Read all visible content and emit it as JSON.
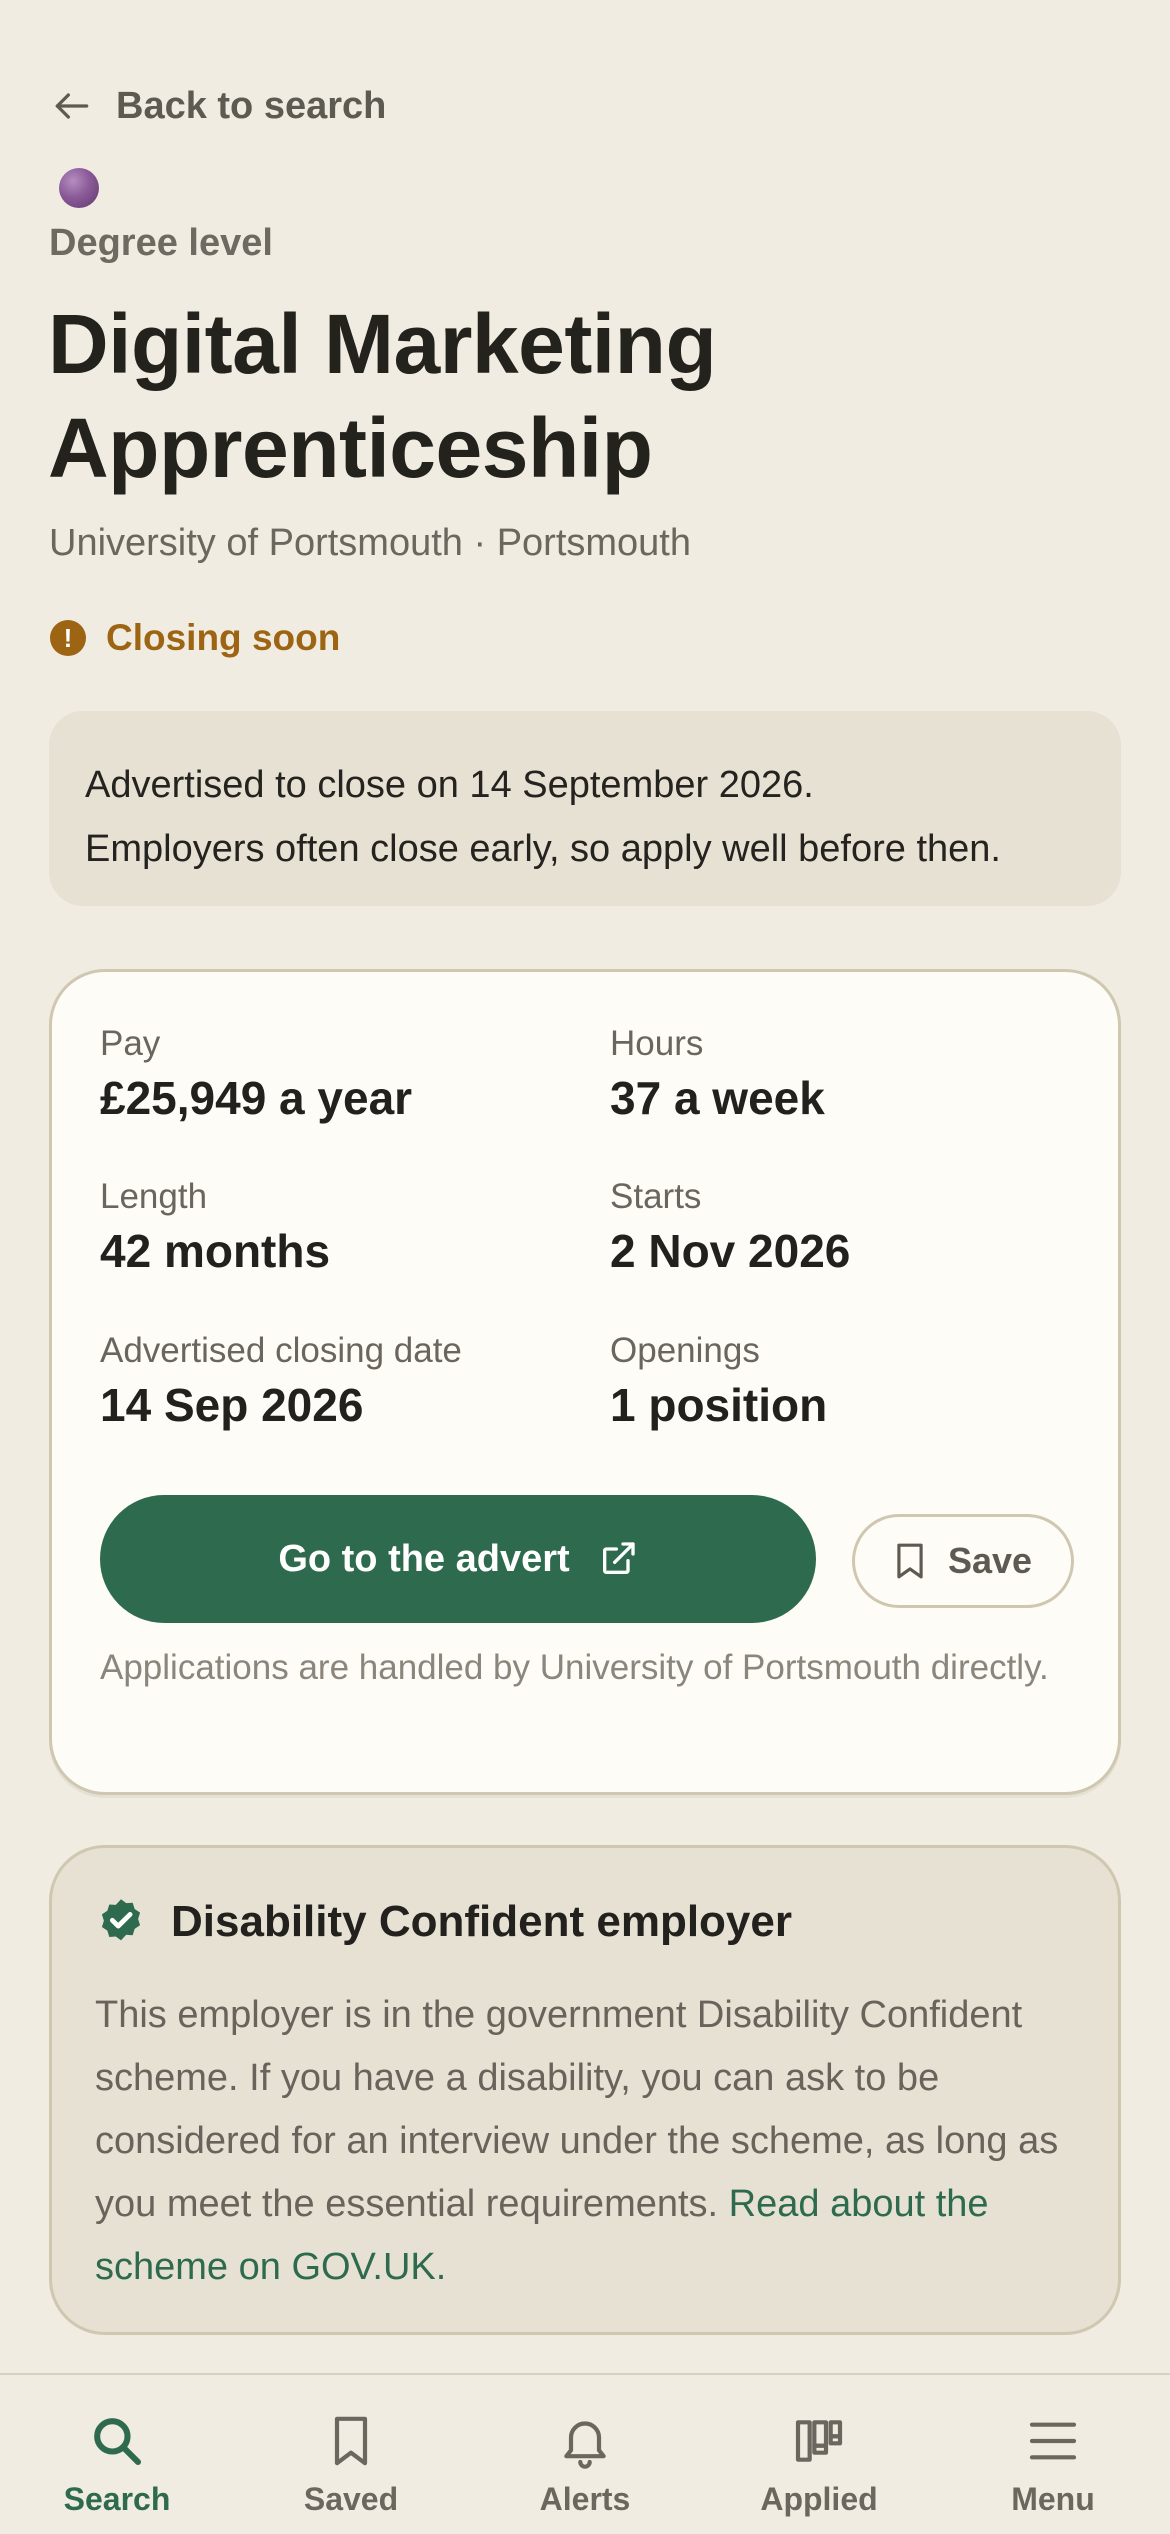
{
  "nav": {
    "back_label": "Back to search"
  },
  "header": {
    "level": "Degree level",
    "title": "Digital Marketing Apprenticeship",
    "subtitle": "University of Portsmouth · Portsmouth",
    "status": "Closing soon",
    "status_color": "#9d6513"
  },
  "notice": {
    "line1": "Advertised to close on 14 September 2026.",
    "line2": "Employers often close early, so apply well before then."
  },
  "facts": [
    {
      "label": "Pay",
      "value": "£25,949 a year"
    },
    {
      "label": "Hours",
      "value": "37 a week"
    },
    {
      "label": "Length",
      "value": "42 months"
    },
    {
      "label": "Starts",
      "value": "2 Nov 2026"
    },
    {
      "label": "Advertised closing date",
      "value": "14 Sep 2026"
    },
    {
      "label": "Openings",
      "value": "1 position"
    }
  ],
  "actions": {
    "go_label": "Go to the advert",
    "save_label": "Save",
    "handled_note": "Applications are handled by University of Portsmouth directly."
  },
  "disability": {
    "title": "Disability Confident employer",
    "body": "This employer is in the government Disability Confident scheme. If you have a disability, you can ask to be considered for an interview under the scheme, as long as you meet the essential requirements.",
    "link": "Read about the scheme on GOV.UK."
  },
  "tabbar": {
    "items": [
      {
        "label": "Search",
        "icon": "search-icon",
        "active": true
      },
      {
        "label": "Saved",
        "icon": "bookmark-icon",
        "active": false
      },
      {
        "label": "Alerts",
        "icon": "bell-icon",
        "active": false
      },
      {
        "label": "Applied",
        "icon": "board-icon",
        "active": false
      },
      {
        "label": "Menu",
        "icon": "menu-icon",
        "active": false
      }
    ]
  },
  "colors": {
    "accent": "#2e6b4e",
    "background": "#f1ece1",
    "card": "#fdfcf7",
    "panel": "#e7e1d4"
  }
}
